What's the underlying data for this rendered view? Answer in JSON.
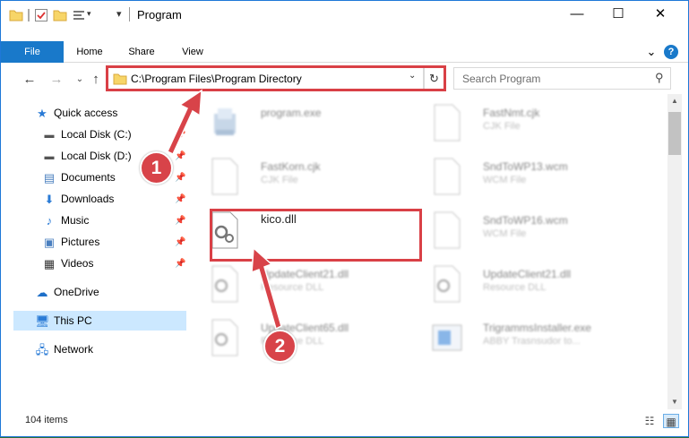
{
  "window": {
    "title": "Program",
    "minimize_glyph": "—",
    "maximize_glyph": "☐",
    "close_glyph": "✕"
  },
  "ribbon": {
    "tabs": [
      "File",
      "Home",
      "Share",
      "View"
    ],
    "expand_glyph": "⌄",
    "help_glyph": "?"
  },
  "nav": {
    "back_glyph": "←",
    "forward_glyph": "→",
    "recent_glyph": "⌄",
    "up_glyph": "↑",
    "address": "C:\\Program Files\\Program Directory",
    "refresh_glyph": "↻",
    "search_placeholder": "Search Program",
    "search_glyph": "⚲"
  },
  "sidebar": {
    "items": [
      {
        "label": "Quick access",
        "icon": "star-icon",
        "pinned": false
      },
      {
        "label": "Local Disk (C:)",
        "icon": "drive-icon",
        "pinned": true
      },
      {
        "label": "Local Disk (D:)",
        "icon": "drive-icon",
        "pinned": true
      },
      {
        "label": "Documents",
        "icon": "documents-icon",
        "pinned": true
      },
      {
        "label": "Downloads",
        "icon": "download-icon",
        "pinned": true
      },
      {
        "label": "Music",
        "icon": "music-icon",
        "pinned": true
      },
      {
        "label": "Pictures",
        "icon": "pictures-icon",
        "pinned": true
      },
      {
        "label": "Videos",
        "icon": "videos-icon",
        "pinned": true
      },
      {
        "label": "OneDrive",
        "icon": "cloud-icon",
        "pinned": false
      },
      {
        "label": "This PC",
        "icon": "computer-icon",
        "pinned": false,
        "selected": true
      },
      {
        "label": "Network",
        "icon": "network-icon",
        "pinned": false
      }
    ]
  },
  "files": [
    {
      "name": "program.exe",
      "type": "",
      "kind": "exe"
    },
    {
      "name": "FastNmt.cjk",
      "type": "CJK File",
      "kind": "doc"
    },
    {
      "name": "FastKorn.cjk",
      "type": "CJK File",
      "kind": "doc"
    },
    {
      "name": "SndToWP13.wcm",
      "type": "WCM File",
      "kind": "doc"
    },
    {
      "name": "kico.dll",
      "type": "",
      "kind": "dll",
      "highlighted": true
    },
    {
      "name": "SndToWP16.wcm",
      "type": "WCM File",
      "kind": "doc"
    },
    {
      "name": "UpdateClient21.dll",
      "type": "Resource DLL",
      "kind": "dll"
    },
    {
      "name": "UpdateClient21.dll",
      "type": "Resource DLL",
      "kind": "dll"
    },
    {
      "name": "UpdateClient65.dll",
      "type": "Resource DLL",
      "kind": "dll"
    },
    {
      "name": "TrigrammsInstaller.exe",
      "type": "ABBY Trasnsudor to...",
      "kind": "exe2"
    }
  ],
  "status": {
    "item_count": "104 items",
    "details_view_glyph": "☷",
    "icons_view_glyph": "▦"
  },
  "callouts": [
    "1",
    "2"
  ],
  "colors": {
    "accent": "#1979ca",
    "highlight_box": "#d94046",
    "callout": "#d84349",
    "selected_row": "#cce8ff"
  }
}
